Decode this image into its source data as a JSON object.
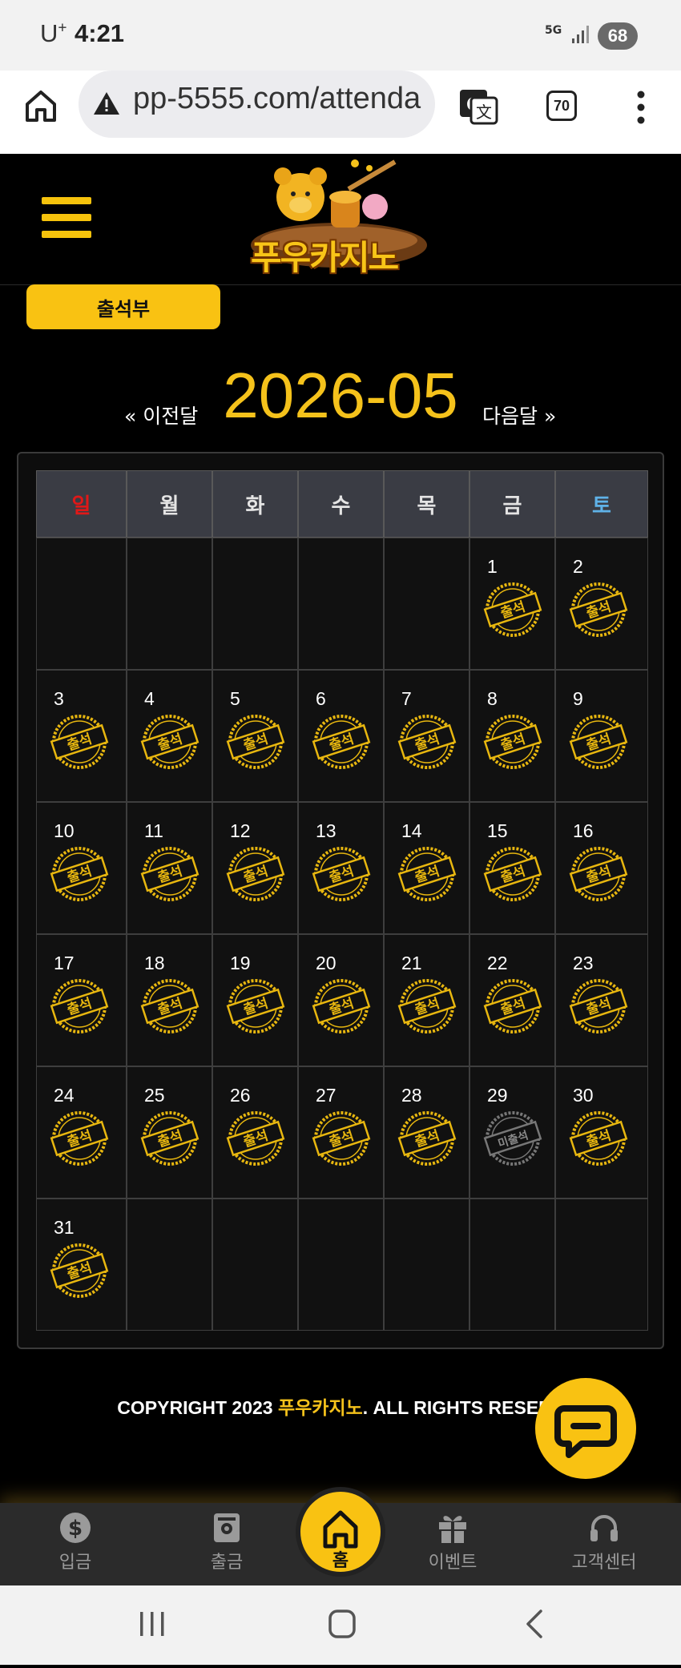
{
  "status_bar": {
    "carrier": "U",
    "carrier_sup": "+",
    "time": "4:21",
    "network": "5G",
    "battery": "68"
  },
  "browser": {
    "url": "pp-5555.com/attenda",
    "tab_count": "70"
  },
  "site": {
    "logo_text": "푸우카지노",
    "attendance_tab": "출석부"
  },
  "calendar": {
    "prev_label": "« 이전달",
    "month": "2026-05",
    "next_label": "다음달 »",
    "weekdays": [
      "일",
      "월",
      "화",
      "수",
      "목",
      "금",
      "토"
    ],
    "weekday_colors": {
      "sunday": "#e01818",
      "saturday": "#5fb2e8",
      "default": "#e4e4e4"
    },
    "stamp_attended": "출석",
    "stamp_absent": "미출석",
    "days": [
      {
        "day": "1",
        "status": "출석"
      },
      {
        "day": "2",
        "status": "출석"
      },
      {
        "day": "3",
        "status": "출석"
      },
      {
        "day": "4",
        "status": "출석"
      },
      {
        "day": "5",
        "status": "출석"
      },
      {
        "day": "6",
        "status": "출석"
      },
      {
        "day": "7",
        "status": "출석"
      },
      {
        "day": "8",
        "status": "출석"
      },
      {
        "day": "9",
        "status": "출석"
      },
      {
        "day": "10",
        "status": "출석"
      },
      {
        "day": "11",
        "status": "출석"
      },
      {
        "day": "12",
        "status": "출석"
      },
      {
        "day": "13",
        "status": "출석"
      },
      {
        "day": "14",
        "status": "출석"
      },
      {
        "day": "15",
        "status": "출석"
      },
      {
        "day": "16",
        "status": "출석"
      },
      {
        "day": "17",
        "status": "출석"
      },
      {
        "day": "18",
        "status": "출석"
      },
      {
        "day": "19",
        "status": "출석"
      },
      {
        "day": "20",
        "status": "출석"
      },
      {
        "day": "21",
        "status": "출석"
      },
      {
        "day": "22",
        "status": "출석"
      },
      {
        "day": "23",
        "status": "출석"
      },
      {
        "day": "24",
        "status": "출석"
      },
      {
        "day": "25",
        "status": "출석"
      },
      {
        "day": "26",
        "status": "출석"
      },
      {
        "day": "27",
        "status": "출석"
      },
      {
        "day": "28",
        "status": "출석"
      },
      {
        "day": "29",
        "status": "미출석"
      },
      {
        "day": "30",
        "status": "출석"
      },
      {
        "day": "31",
        "status": "출석"
      }
    ],
    "first_weekday_index": 5
  },
  "footer": {
    "copyright_prefix": "COPYRIGHT 2023 ",
    "copyright_brand": "푸우카지노",
    "copyright_suffix": ". ALL RIGHTS RESERV"
  },
  "bottom_nav": {
    "deposit": "입금",
    "withdraw": "출금",
    "home": "홈",
    "event": "이벤트",
    "support": "고객센터"
  },
  "colors": {
    "accent": "#f9c212",
    "background": "#000000"
  }
}
